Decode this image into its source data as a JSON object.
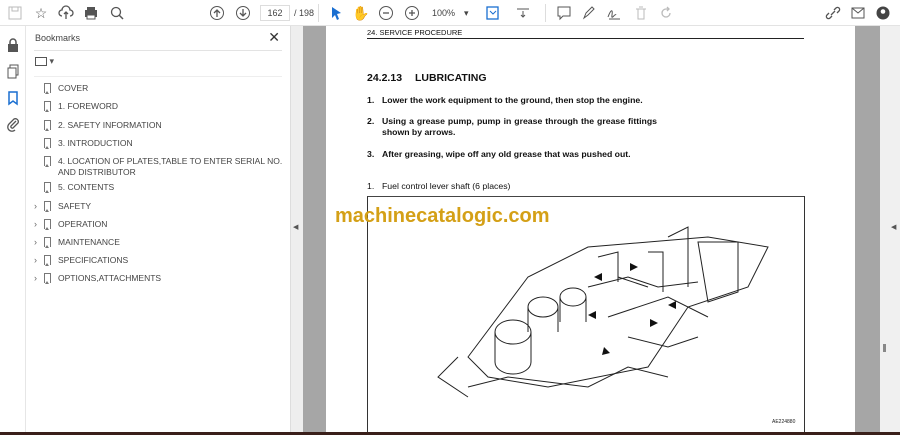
{
  "toolbar": {
    "page_current": "162",
    "page_total": "/ 198",
    "zoom": "100%",
    "icons": [
      "save-icon",
      "bookmark-star-icon",
      "upload-cloud-icon",
      "print-icon",
      "search-zoom-icon",
      "page-up-icon",
      "page-down-icon",
      "select-cursor-icon",
      "hand-icon",
      "zoom-out-icon",
      "zoom-in-icon",
      "fit-page-icon",
      "scroll-mode-icon",
      "comment-icon",
      "pen-icon",
      "sign-icon",
      "delete-icon",
      "rotate-icon",
      "share-link-icon",
      "email-icon",
      "account-icon"
    ]
  },
  "bookmarks": {
    "title": "Bookmarks",
    "close": "✕",
    "items": [
      {
        "label": "COVER",
        "expandable": false
      },
      {
        "label": "1. FOREWORD",
        "expandable": false
      },
      {
        "label": "2. SAFETY INFORMATION",
        "expandable": false
      },
      {
        "label": "3. INTRODUCTION",
        "expandable": false
      },
      {
        "label": "4. LOCATION OF PLATES,TABLE TO ENTER SERIAL NO. AND DISTRIBUTOR",
        "expandable": false
      },
      {
        "label": "5. CONTENTS",
        "expandable": false
      },
      {
        "label": "SAFETY",
        "expandable": true
      },
      {
        "label": "OPERATION",
        "expandable": true
      },
      {
        "label": "MAINTENANCE",
        "expandable": true
      },
      {
        "label": "SPECIFICATIONS",
        "expandable": true
      },
      {
        "label": "OPTIONS,ATTACHMENTS",
        "expandable": true
      }
    ]
  },
  "document": {
    "header": "24. SERVICE PROCEDURE",
    "title": "24.2.13 LUBRICATING",
    "steps": [
      {
        "n": "1.",
        "text": "Lower the work equipment to the ground, then stop the engine."
      },
      {
        "n": "2.",
        "text": "Using a grease pump, pump in grease through the grease fittings shown by arrows."
      },
      {
        "n": "3.",
        "text": "After greasing, wipe off any old grease that was pushed out."
      }
    ],
    "figure_caption_n": "1.",
    "figure_caption": "Fuel control lever shaft (6 places)",
    "figure_code": "AE224880",
    "watermark": "machinecatalogic.com"
  },
  "colors": {
    "watermark": "#d4a017",
    "accent": "#1a6fd1"
  }
}
